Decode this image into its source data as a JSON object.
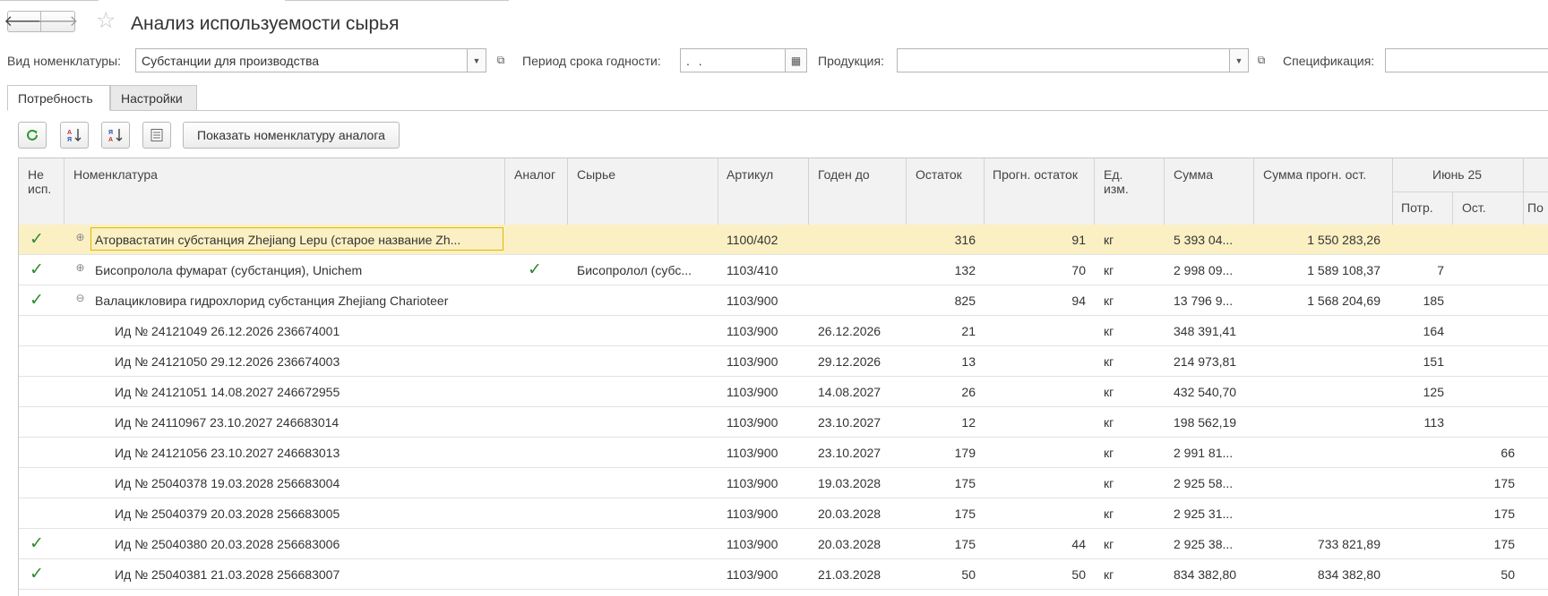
{
  "window": {
    "title": "Анализ используемости сырья",
    "back_icon": "arrow-left-icon",
    "forward_icon": "arrow-right-icon",
    "favorite_icon": "star-icon"
  },
  "filters": {
    "vid_label": "Вид номенклатуры:",
    "vid_value": "Субстанции для производства",
    "period_label": "Период срока годности:",
    "period_value": " .  .",
    "product_label": "Продукция:",
    "product_value": "",
    "spec_label": "Спецификация:",
    "spec_value": ""
  },
  "tabs": [
    {
      "label": "Потребность",
      "active": true
    },
    {
      "label": "Настройки",
      "active": false
    }
  ],
  "toolbar": {
    "refresh_icon": "refresh-icon",
    "sort_asc_icon": "sort-asc-icon",
    "sort_desc_icon": "sort-desc-icon",
    "list_icon": "list-icon",
    "analog_button": "Показать номенклатуру аналога"
  },
  "columns": {
    "ne_isp": "Не исп.",
    "nomenclature": "Номенклатура",
    "analog": "Аналог",
    "raw": "Сырье",
    "article": "Артикул",
    "valid_to": "Годен до",
    "balance": "Остаток",
    "forecast_balance": "Прогн. остаток",
    "unit": "Ед. изм.",
    "sum": "Сумма",
    "forecast_sum": "Сумма прогн. ост.",
    "month_group": "Июнь 25",
    "month_need": "Потр.",
    "month_rest": "Ост.",
    "next_group_need": "По"
  },
  "rows": [
    {
      "checked": true,
      "expander": "plus",
      "indent": 0,
      "name": "Аторвастатин субстанция  Zhejiang Lepu (старое название Zh...",
      "analog": false,
      "raw": "",
      "article": "1100/402",
      "valid_to": "",
      "balance": "316",
      "forecast": "91",
      "unit": "кг",
      "sum": "5 393 04...",
      "forecast_sum": "1 550 283,26",
      "need": "",
      "rest": "",
      "selected": true
    },
    {
      "checked": true,
      "expander": "plus",
      "indent": 0,
      "name": "Бисопролола фумарат (субстанция), Unichem",
      "analog": true,
      "raw": "Бисопролол (субс...",
      "article": "1103/410",
      "valid_to": "",
      "balance": "132",
      "forecast": "70",
      "unit": "кг",
      "sum": "2 998 09...",
      "forecast_sum": "1 589 108,37",
      "need": "7",
      "rest": "",
      "selected": false
    },
    {
      "checked": true,
      "expander": "minus",
      "indent": 0,
      "name": "Валацикловира гидрохлорид субстанция Zhejiang Charioteer",
      "analog": false,
      "raw": "",
      "article": "1103/900",
      "valid_to": "",
      "balance": "825",
      "forecast": "94",
      "unit": "кг",
      "sum": "13 796 9...",
      "forecast_sum": "1 568 204,69",
      "need": "185",
      "rest": "",
      "selected": false
    },
    {
      "checked": false,
      "expander": "",
      "indent": 1,
      "name": "Ид № 24121049 26.12.2026 236674001",
      "analog": false,
      "raw": "",
      "article": "1103/900",
      "valid_to": "26.12.2026",
      "balance": "21",
      "forecast": "",
      "unit": "кг",
      "sum": "348 391,41",
      "forecast_sum": "",
      "need": "164",
      "rest": "",
      "selected": false
    },
    {
      "checked": false,
      "expander": "",
      "indent": 1,
      "name": "Ид № 24121050 29.12.2026 236674003",
      "analog": false,
      "raw": "",
      "article": "1103/900",
      "valid_to": "29.12.2026",
      "balance": "13",
      "forecast": "",
      "unit": "кг",
      "sum": "214 973,81",
      "forecast_sum": "",
      "need": "151",
      "rest": "",
      "selected": false
    },
    {
      "checked": false,
      "expander": "",
      "indent": 1,
      "name": "Ид № 24121051 14.08.2027 246672955",
      "analog": false,
      "raw": "",
      "article": "1103/900",
      "valid_to": "14.08.2027",
      "balance": "26",
      "forecast": "",
      "unit": "кг",
      "sum": "432 540,70",
      "forecast_sum": "",
      "need": "125",
      "rest": "",
      "selected": false
    },
    {
      "checked": false,
      "expander": "",
      "indent": 1,
      "name": "Ид № 24110967 23.10.2027 246683014",
      "analog": false,
      "raw": "",
      "article": "1103/900",
      "valid_to": "23.10.2027",
      "balance": "12",
      "forecast": "",
      "unit": "кг",
      "sum": "198 562,19",
      "forecast_sum": "",
      "need": "113",
      "rest": "",
      "selected": false
    },
    {
      "checked": false,
      "expander": "",
      "indent": 1,
      "name": "Ид № 24121056 23.10.2027 246683013",
      "analog": false,
      "raw": "",
      "article": "1103/900",
      "valid_to": "23.10.2027",
      "balance": "179",
      "forecast": "",
      "unit": "кг",
      "sum": "2 991 81...",
      "forecast_sum": "",
      "need": "",
      "rest": "66",
      "selected": false
    },
    {
      "checked": false,
      "expander": "",
      "indent": 1,
      "name": "Ид № 25040378 19.03.2028 256683004",
      "analog": false,
      "raw": "",
      "article": "1103/900",
      "valid_to": "19.03.2028",
      "balance": "175",
      "forecast": "",
      "unit": "кг",
      "sum": "2 925 58...",
      "forecast_sum": "",
      "need": "",
      "rest": "175",
      "selected": false
    },
    {
      "checked": false,
      "expander": "",
      "indent": 1,
      "name": "Ид № 25040379 20.03.2028 256683005",
      "analog": false,
      "raw": "",
      "article": "1103/900",
      "valid_to": "20.03.2028",
      "balance": "175",
      "forecast": "",
      "unit": "кг",
      "sum": "2 925 31...",
      "forecast_sum": "",
      "need": "",
      "rest": "175",
      "selected": false
    },
    {
      "checked": true,
      "expander": "",
      "indent": 1,
      "name": "Ид № 25040380 20.03.2028 256683006",
      "analog": false,
      "raw": "",
      "article": "1103/900",
      "valid_to": "20.03.2028",
      "balance": "175",
      "forecast": "44",
      "unit": "кг",
      "sum": "2 925 38...",
      "forecast_sum": "733 821,89",
      "need": "",
      "rest": "175",
      "selected": false
    },
    {
      "checked": true,
      "expander": "",
      "indent": 1,
      "name": "Ид № 25040381 21.03.2028 256683007",
      "analog": false,
      "raw": "",
      "article": "1103/900",
      "valid_to": "21.03.2028",
      "balance": "50",
      "forecast": "50",
      "unit": "кг",
      "sum": "834 382,80",
      "forecast_sum": "834 382,80",
      "need": "",
      "rest": "50",
      "selected": false
    }
  ],
  "colors": {
    "selected_row": "#fbf0c3",
    "check": "#2e8b2e",
    "header_bg": "#f2f2f2"
  }
}
